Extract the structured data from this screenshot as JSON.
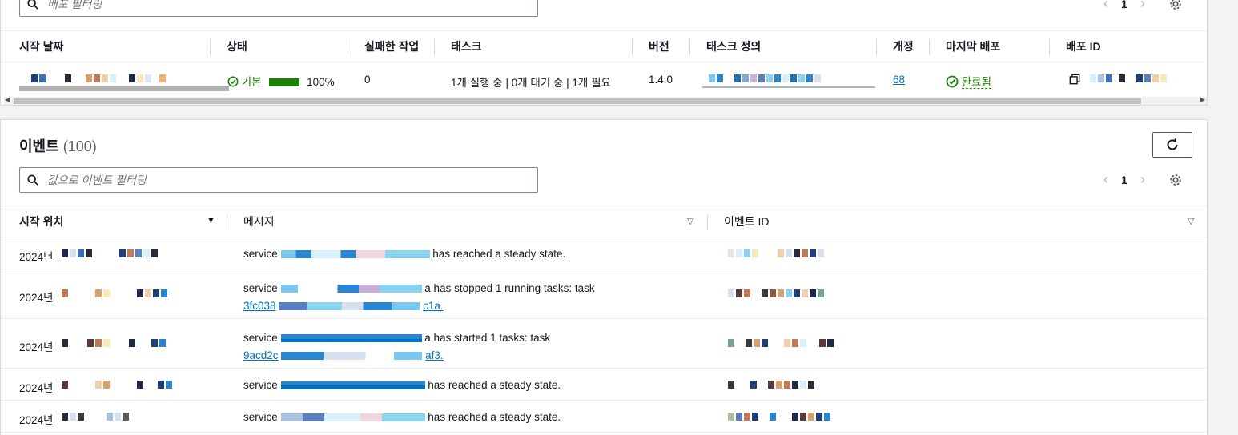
{
  "deployments": {
    "filter_placeholder": "배포 필터링",
    "page": "1",
    "columns": [
      "시작 날짜",
      "상태",
      "실패한 작업",
      "태스크",
      "버전",
      "태스크 정의",
      "개정",
      "마지막 배포",
      "배포 ID"
    ],
    "row": {
      "status": "기본",
      "progress": "100%",
      "progress_fraction": 1.0,
      "failed_tasks": "0",
      "tasks": "1개 실행 중 | 0개 대기 중 | 1개 필요",
      "version": "1.4.0",
      "revision": "68",
      "last_deploy": "완료됨"
    }
  },
  "events": {
    "title": "이벤트",
    "count": "(100)",
    "filter_placeholder": "값으로 이벤트 필터링",
    "page": "1",
    "columns": [
      "시작 위치",
      "메시지",
      "이벤트 ID"
    ],
    "rows": [
      {
        "date": "2024년",
        "msg_prefix": "service",
        "msg_suffix": "has reached a steady state.",
        "line2_start": "",
        "line2_end": ""
      },
      {
        "date": "2024년",
        "msg_prefix": "service",
        "msg_suffix": "a has stopped 1 running tasks: task",
        "line2_start": "3fc038",
        "line2_end": "c1a."
      },
      {
        "date": "2024년",
        "msg_prefix": "service",
        "msg_suffix": "a has started 1 tasks: task",
        "line2_start": "9acd2c",
        "line2_end": "af3."
      },
      {
        "date": "2024년",
        "msg_prefix": "service",
        "msg_suffix": "has reached a steady state.",
        "line2_start": "",
        "line2_end": ""
      },
      {
        "date": "2024년",
        "msg_prefix": "service",
        "msg_suffix": "has reached a steady state.",
        "line2_start": "",
        "line2_end": ""
      }
    ]
  },
  "colors": {
    "link": "#0073bb",
    "success": "#1d8102",
    "border": "#d5dbdb"
  }
}
